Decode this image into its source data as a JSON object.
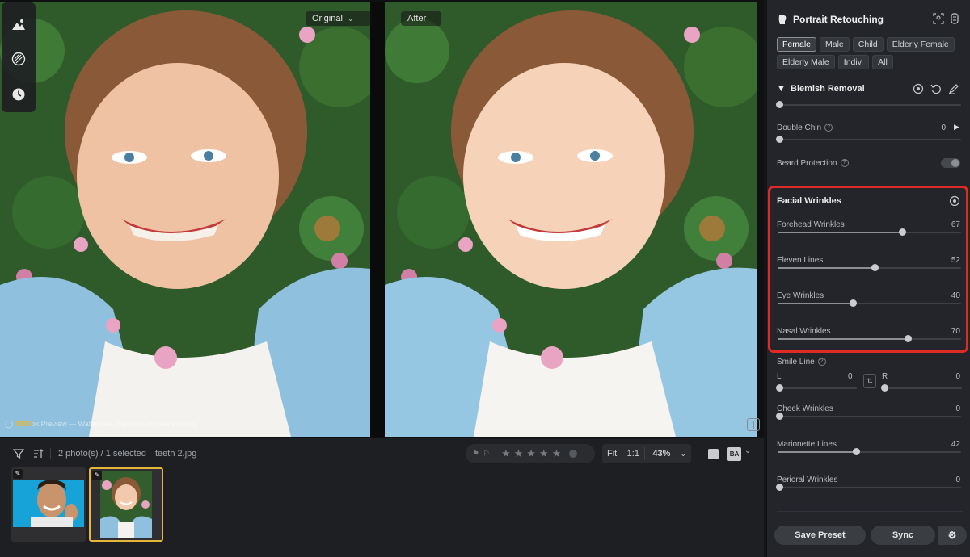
{
  "preview": {
    "original_label": "Original",
    "after_label": "After",
    "watermark_prefix": "3000",
    "watermark_text": "px Preview — Watermark displayed in preview only."
  },
  "toolbar_left": {
    "icons": [
      "portrait-mountain-icon",
      "texture-icon",
      "history-clock-icon"
    ]
  },
  "bottom": {
    "count_text": "2 photo(s) / 1 selected",
    "file_name": "teeth 2.jpg",
    "zoom_fit": "Fit",
    "zoom_1to1": "1:1",
    "zoom_value": "43%",
    "ba_label": "BA"
  },
  "panel": {
    "title": "Portrait Retouching",
    "chips": [
      "Female",
      "Male",
      "Child",
      "Elderly Female",
      "Elderly Male",
      "Indiv.",
      "All"
    ],
    "active_chip": "Female",
    "blemish": {
      "title": "Blemish Removal"
    },
    "double_chin": {
      "label": "Double Chin",
      "value": "0"
    },
    "beard": {
      "label": "Beard Protection"
    },
    "wrinkles": {
      "title": "Facial Wrinkles",
      "rows": [
        {
          "label": "Forehead Wrinkles",
          "value": "67",
          "pct": 67
        },
        {
          "label": "Eleven Lines",
          "value": "52",
          "pct": 52
        },
        {
          "label": "Eye Wrinkles",
          "value": "40",
          "pct": 40
        },
        {
          "label": "Nasal Wrinkles",
          "value": "70",
          "pct": 70
        }
      ]
    },
    "smile_line": {
      "label": "Smile Line",
      "l_label": "L",
      "l_value": "0",
      "r_label": "R",
      "r_value": "0"
    },
    "more_rows": [
      {
        "label": "Cheek Wrinkles",
        "value": "0",
        "pct": 0
      },
      {
        "label": "Marionette Lines",
        "value": "42",
        "pct": 42
      },
      {
        "label": "Perioral Wrinkles",
        "value": "0",
        "pct": 0
      }
    ],
    "save_preset": "Save Preset",
    "sync": "Sync"
  },
  "colors": {
    "highlight": "#e12a25",
    "thumb_selected": "#e7b53a"
  }
}
